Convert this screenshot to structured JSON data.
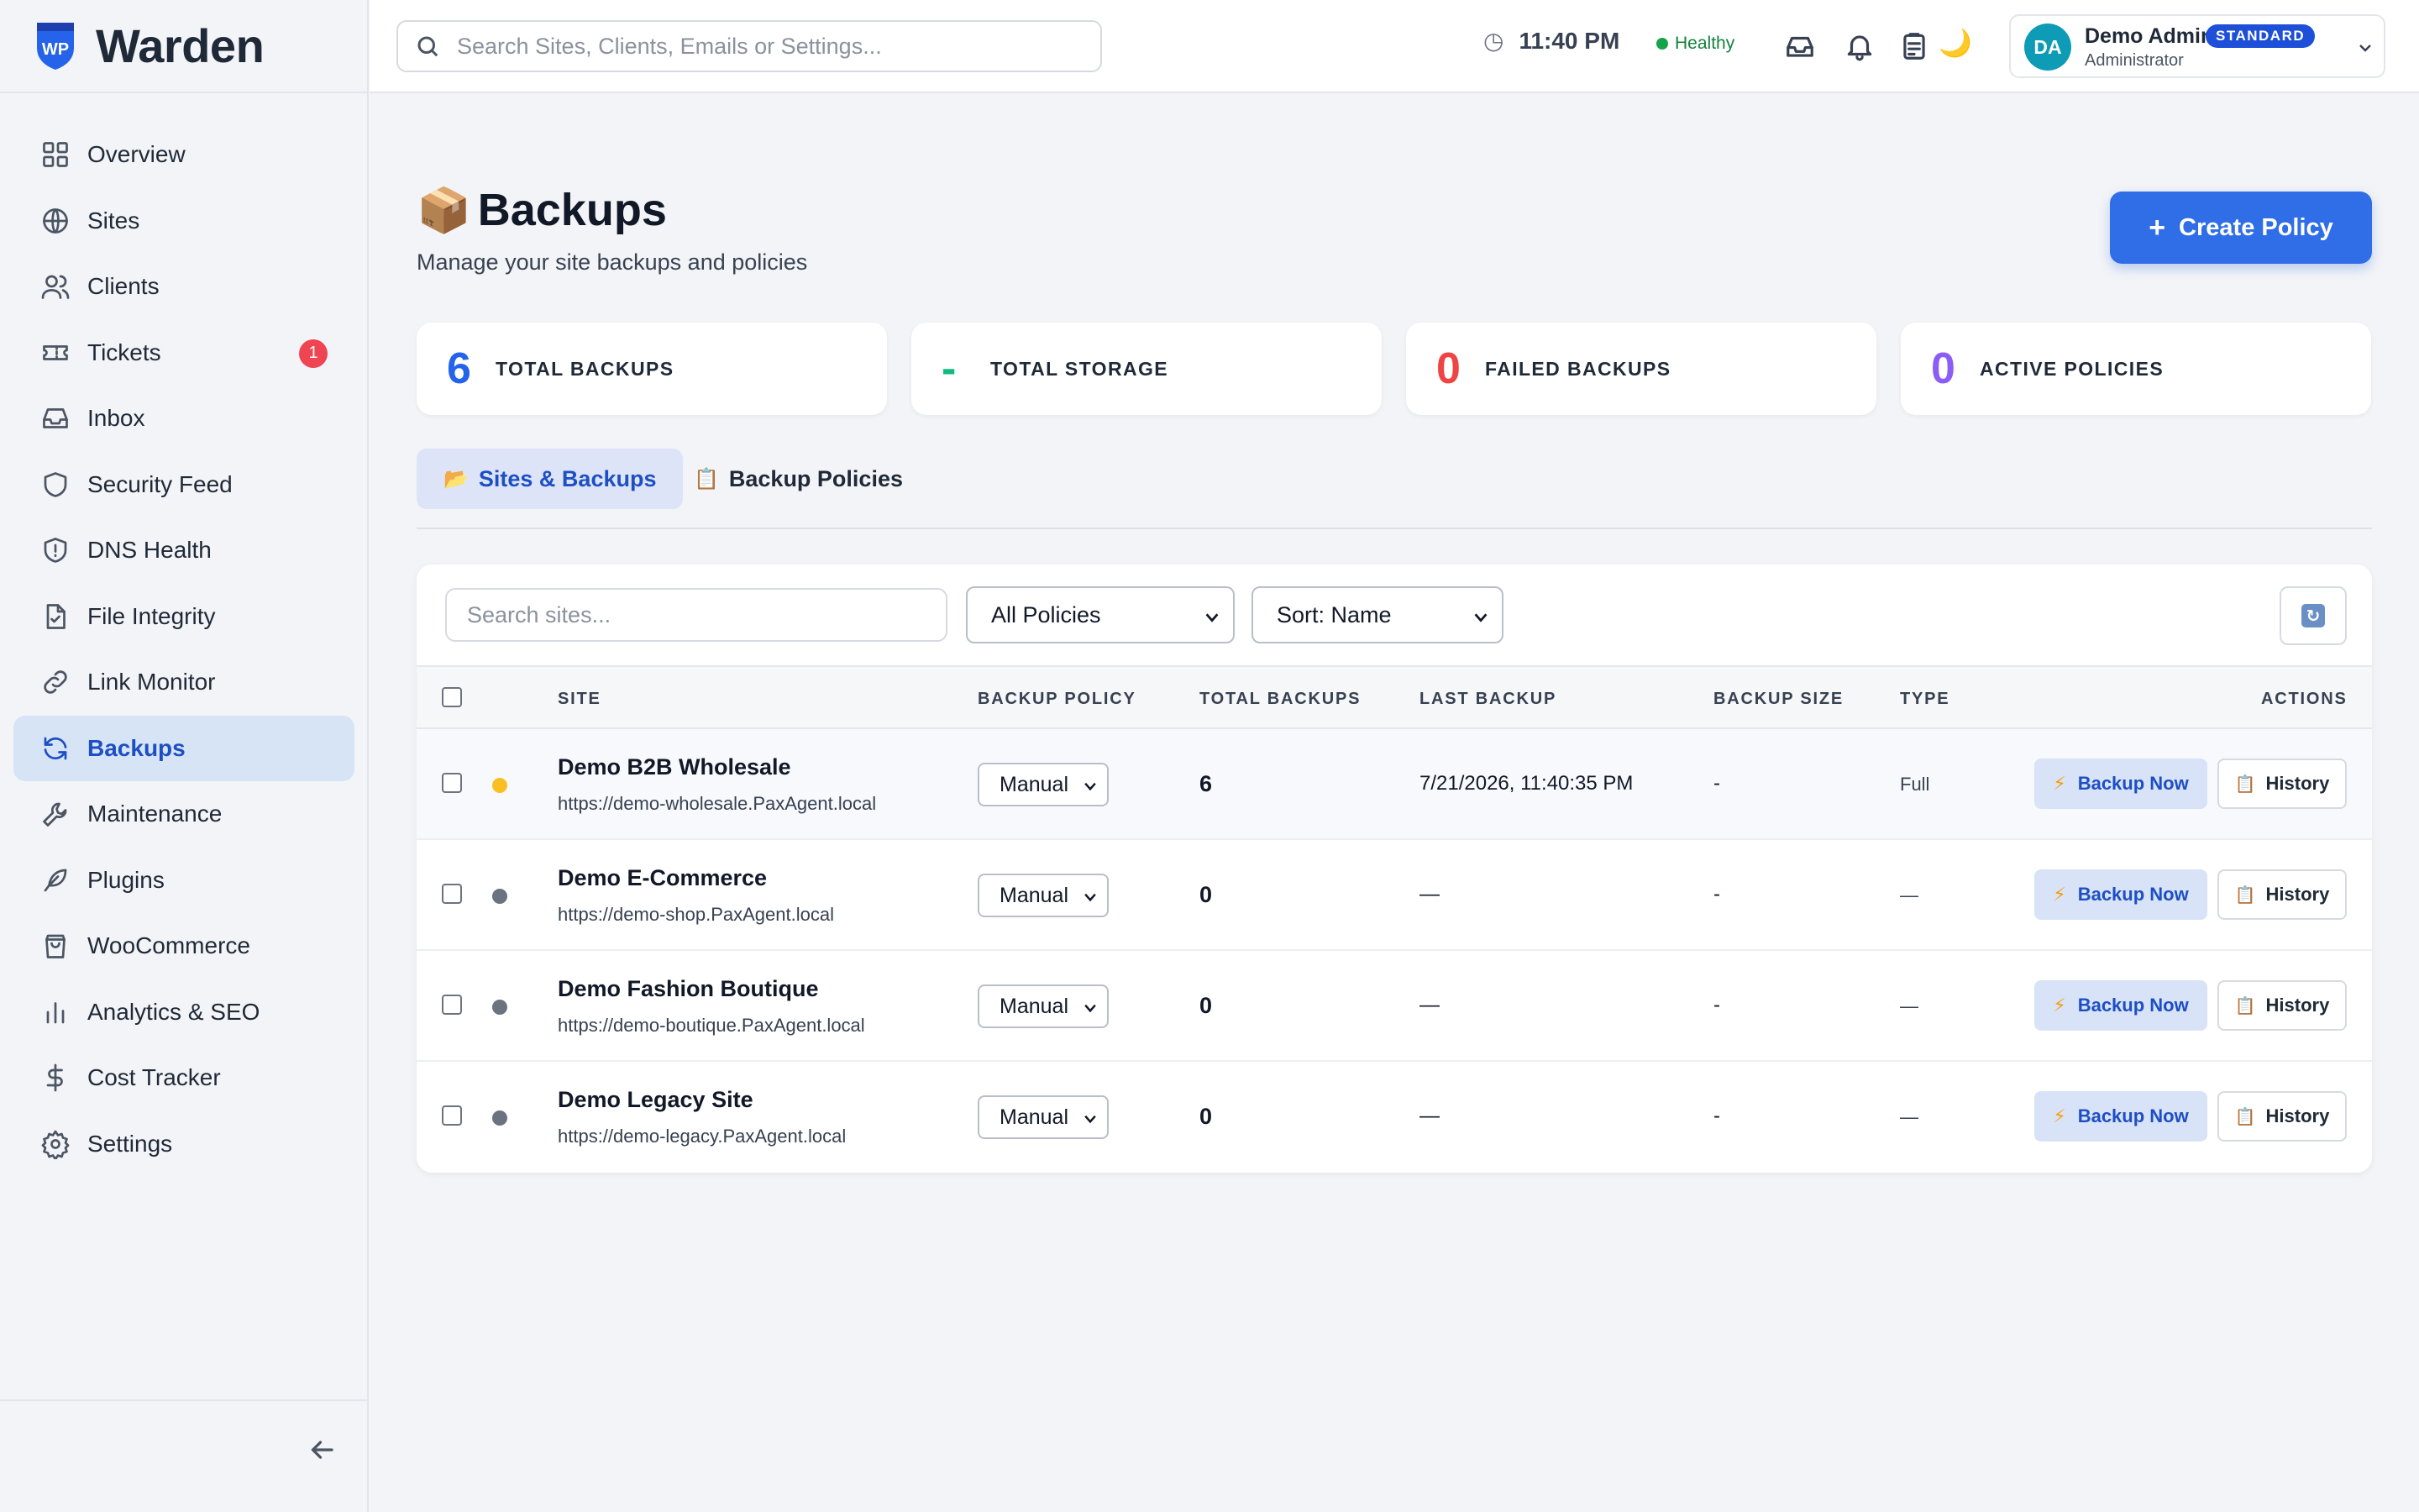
{
  "brand": {
    "name": "Warden",
    "logo_text": "WP",
    "logo_color": "#2563eb"
  },
  "nav": {
    "items": [
      {
        "label": "Overview",
        "icon": "grid-icon"
      },
      {
        "label": "Sites",
        "icon": "globe-icon"
      },
      {
        "label": "Clients",
        "icon": "users-icon"
      },
      {
        "label": "Tickets",
        "icon": "ticket-icon",
        "badge": "1"
      },
      {
        "label": "Inbox",
        "icon": "inbox-icon"
      },
      {
        "label": "Security Feed",
        "icon": "shield-icon"
      },
      {
        "label": "DNS Health",
        "icon": "shield-alert-icon"
      },
      {
        "label": "File Integrity",
        "icon": "file-check-icon"
      },
      {
        "label": "Link Monitor",
        "icon": "link-icon"
      },
      {
        "label": "Backups",
        "icon": "refresh-icon",
        "active": true
      },
      {
        "label": "Maintenance",
        "icon": "wrench-icon"
      },
      {
        "label": "Plugins",
        "icon": "feather-icon"
      },
      {
        "label": "WooCommerce",
        "icon": "shopping-bag-icon"
      },
      {
        "label": "Analytics & SEO",
        "icon": "bar-chart-icon"
      },
      {
        "label": "Cost Tracker",
        "icon": "dollar-icon"
      },
      {
        "label": "Settings",
        "icon": "gear-icon"
      }
    ],
    "collapse_icon": "arrow-left-icon"
  },
  "header": {
    "search_placeholder": "Search Sites, Clients, Emails or Settings...",
    "time": "11:40 PM",
    "health": "Healthy",
    "user": {
      "initials": "DA",
      "name": "Demo Admin",
      "tier": "STANDARD",
      "role": "Administrator"
    }
  },
  "page": {
    "emoji": "📦",
    "title": "Backups",
    "subtitle": "Manage your site backups and policies",
    "create_label": "Create Policy"
  },
  "stats": [
    {
      "value": "6",
      "label": "TOTAL BACKUPS",
      "color": "#2563eb"
    },
    {
      "value": "-",
      "label": "TOTAL STORAGE",
      "color": "#10b981"
    },
    {
      "value": "0",
      "label": "FAILED BACKUPS",
      "color": "#ef4444"
    },
    {
      "value": "0",
      "label": "ACTIVE POLICIES",
      "color": "#8b5cf6"
    }
  ],
  "tabs": [
    {
      "icon": "📂",
      "label": "Sites & Backups",
      "active": true
    },
    {
      "icon": "📋",
      "label": "Backup Policies"
    }
  ],
  "filters": {
    "search_placeholder": "Search sites...",
    "policy_filter": "All Policies",
    "sort": "Sort: Name",
    "refresh_glyph": "↻"
  },
  "table": {
    "columns": [
      "SITE",
      "BACKUP POLICY",
      "TOTAL BACKUPS",
      "LAST BACKUP",
      "BACKUP SIZE",
      "TYPE",
      "ACTIONS"
    ],
    "backup_now_label": "Backup Now",
    "history_label": "History",
    "rows": [
      {
        "name": "Demo B2B Wholesale",
        "url": "https://demo-wholesale.PaxAgent.local",
        "policy": "Manual",
        "total": "6",
        "last": "7/21/2026, 11:40:35 PM",
        "size": "-",
        "type": "Full",
        "status_color": "#fbbf24"
      },
      {
        "name": "Demo E-Commerce",
        "url": "https://demo-shop.PaxAgent.local",
        "policy": "Manual",
        "total": "0",
        "last": "—",
        "size": "-",
        "type": "—",
        "status_color": "#6b7280"
      },
      {
        "name": "Demo Fashion Boutique",
        "url": "https://demo-boutique.PaxAgent.local",
        "policy": "Manual",
        "total": "0",
        "last": "—",
        "size": "-",
        "type": "—",
        "status_color": "#6b7280"
      },
      {
        "name": "Demo Legacy Site",
        "url": "https://demo-legacy.PaxAgent.local",
        "policy": "Manual",
        "total": "0",
        "last": "—",
        "size": "-",
        "type": "—",
        "status_color": "#6b7280"
      }
    ]
  }
}
